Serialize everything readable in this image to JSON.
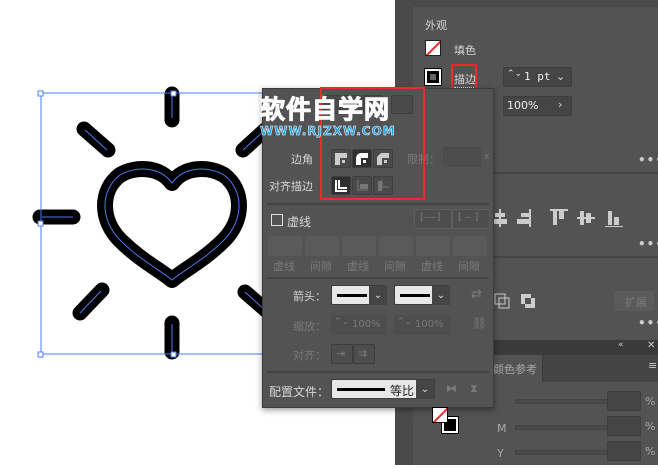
{
  "watermark": {
    "title": "软件自学网",
    "url": "WWW.RJZXW.COM"
  },
  "appearance": {
    "section": "外观",
    "fill_label": "填色",
    "stroke_label": "描边",
    "stroke_weight": "1 pt",
    "opacity": "100%"
  },
  "more": "•••",
  "stroke_popup": {
    "corner_label": "边角",
    "limit_label": "限制：",
    "limit_suffix": "x",
    "align_label": "对齐描边",
    "dashed_label": "虚线",
    "dash_fields": [
      "虚线",
      "间隙",
      "虚线",
      "间隙",
      "虚线",
      "间隙"
    ],
    "arrow_label": "箭头：",
    "scale_label": "缩放：",
    "scale_start": "100%",
    "scale_end": "100%",
    "arrow_align_label": "对齐：",
    "profile_label": "配置文件：",
    "profile_value": "等比"
  },
  "pathfinder": {
    "expand_label": "扩展"
  },
  "color_panel": {
    "tab": "颜色参考",
    "channels": [
      "",
      "M",
      "Y"
    ],
    "unit": "%"
  },
  "colors": {
    "accent": "#4a7cf0",
    "highlight": "#f02a2a",
    "watermark": "#1a7fd0"
  }
}
